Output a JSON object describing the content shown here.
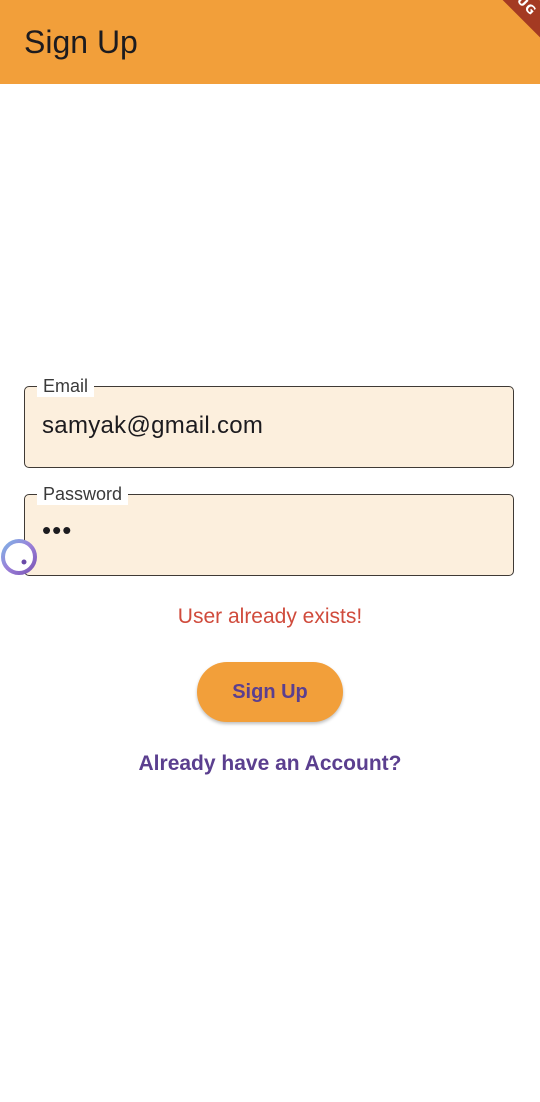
{
  "app_bar": {
    "title": "Sign Up",
    "debug_banner": "DEBUG",
    "color": "#f29f3a"
  },
  "form": {
    "email": {
      "label": "Email",
      "value": "samyak@gmail.com"
    },
    "password": {
      "label": "Password",
      "value": "•••"
    },
    "error_message": "User already exists!",
    "submit_label": "Sign Up",
    "login_link": "Already have an Account?"
  },
  "colors": {
    "accent": "#f29f3a",
    "field_fill": "#fcefdd",
    "error": "#d04b3c",
    "primary_text": "#5b3f8f"
  },
  "icons": {
    "floating_bubble": "assistant-bubble-icon",
    "debug_ribbon": "debug-banner"
  }
}
